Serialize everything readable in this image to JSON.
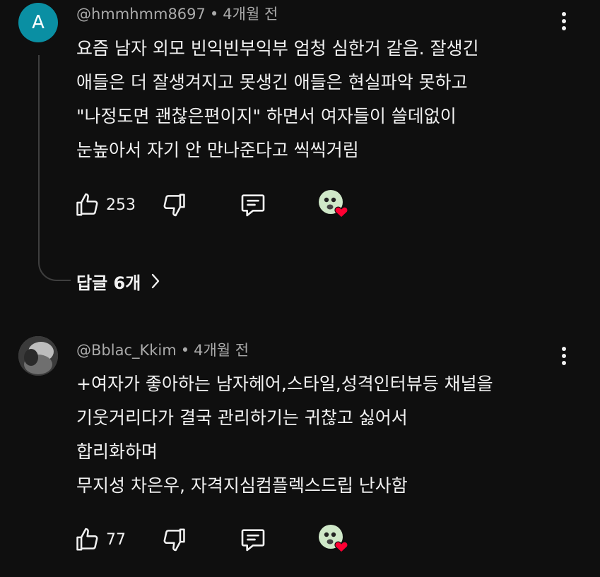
{
  "comments": [
    {
      "avatar_letter": "A",
      "avatar_color": "#0a8fa3",
      "author": "@hmmhmm8697",
      "separator": "•",
      "time": "4개월 전",
      "lines": [
        "요즘 남자 외모 빈익빈부익부 엄청 심한거 같음. 잘생긴",
        "애들은 더 잘생겨지고 못생긴 애들은 현실파악 못하고",
        "\"나정도면 괜찮은편이지\" 하면서 여자들이 쓸데없이",
        "눈높아서 자기 안 만나준다고 씩씩거림"
      ],
      "like_count": "253",
      "replies_label": "답글 6개"
    },
    {
      "author": "@Bblac_Kkim",
      "separator": "•",
      "time": "4개월 전",
      "lines": [
        "+여자가 좋아하는 남자헤어,스타일,성격인터뷰등 채널을",
        "기웃거리다가 결국 관리하기는 귀찮고 싫어서",
        "합리화하며",
        "무지성 차은우, 자격지심컴플렉스드립 난사함"
      ],
      "like_count": "77"
    }
  ],
  "icons": {
    "like": "thumbs-up-icon",
    "dislike": "thumbs-down-icon",
    "reply": "comment-icon",
    "creator_heart": "creator-heart-avatar-icon",
    "more": "more-vertical-icon",
    "chevron": "chevron-right-icon"
  },
  "colors": {
    "background": "#0f0f0f",
    "text": "#f1f1f1",
    "meta": "#aaaaaa",
    "heart": "#ff0033"
  }
}
